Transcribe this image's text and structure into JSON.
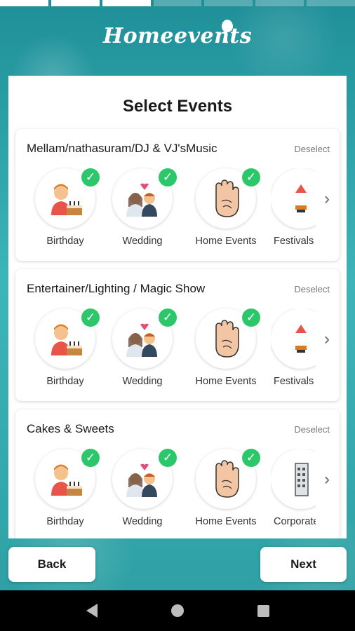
{
  "app": {
    "logo_text": "Homeevents"
  },
  "progress": {
    "segments": 7,
    "completed": 3
  },
  "page_title": "Select Events",
  "categories": [
    {
      "title": "Mellam/nathasuram/DJ & VJ'sMusic",
      "deselect_label": "Deselect",
      "events": [
        {
          "label": "Birthday",
          "icon": "birthday-icon",
          "selected": true
        },
        {
          "label": "Wedding",
          "icon": "wedding-icon",
          "selected": true
        },
        {
          "label": "Home Events",
          "icon": "hand-icon",
          "selected": true
        },
        {
          "label": "Festivals",
          "icon": "festival-icon",
          "selected": false
        }
      ]
    },
    {
      "title": "Entertainer/Lighting / Magic Show",
      "deselect_label": "Deselect",
      "events": [
        {
          "label": "Birthday",
          "icon": "birthday-icon",
          "selected": true
        },
        {
          "label": "Wedding",
          "icon": "wedding-icon",
          "selected": true
        },
        {
          "label": "Home Events",
          "icon": "hand-icon",
          "selected": true
        },
        {
          "label": "Festivals",
          "icon": "festival-icon",
          "selected": false
        }
      ]
    },
    {
      "title": "Cakes & Sweets",
      "deselect_label": "Deselect",
      "events": [
        {
          "label": "Birthday",
          "icon": "birthday-icon",
          "selected": true
        },
        {
          "label": "Wedding",
          "icon": "wedding-icon",
          "selected": true
        },
        {
          "label": "Home Events",
          "icon": "hand-icon",
          "selected": true
        },
        {
          "label": "Corporate",
          "icon": "corporate-icon",
          "selected": false
        }
      ]
    }
  ],
  "buttons": {
    "back": "Back",
    "next": "Next"
  },
  "colors": {
    "accent": "#2a9fa6",
    "check": "#2cc76b"
  }
}
